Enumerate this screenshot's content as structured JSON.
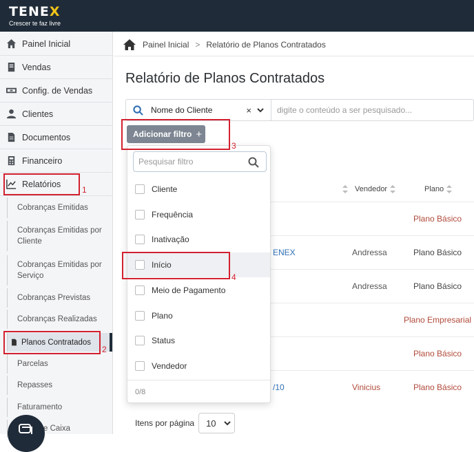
{
  "header": {
    "brand": "TENE",
    "brand_x": "X",
    "tagline": "Crescer te faz livre"
  },
  "sidebar": {
    "items": [
      {
        "label": "Painel Inicial",
        "icon": "home-icon"
      },
      {
        "label": "Vendas",
        "icon": "book-icon"
      },
      {
        "label": "Config. de Vendas",
        "icon": "money-icon"
      },
      {
        "label": "Clientes",
        "icon": "user-icon"
      },
      {
        "label": "Documentos",
        "icon": "document-icon"
      },
      {
        "label": "Financeiro",
        "icon": "calculator-icon"
      },
      {
        "label": "Relatórios",
        "icon": "chart-line-icon"
      }
    ],
    "subitems": [
      "Cobranças Emitidas",
      "Cobranças Emitidas por Cliente",
      "Cobranças Emitidas por Serviço",
      "Cobranças Previstas",
      "Cobranças Realizadas",
      "Planos Contratados",
      "Parcelas",
      "Repasses",
      "Faturamento",
      "Fluxo de Caixa"
    ],
    "subitems_visible": [
      "Cobranças Emitidas",
      "Cobranças Emitidas por\nCliente",
      "Cobranças Emitidas por\nServiço",
      "Cobranças Previstas",
      "Cobranças Realizadas",
      "Planos Contratados",
      "Parcelas",
      "Repasses",
      "Faturamento",
      "e Caixa"
    ]
  },
  "breadcrumb": {
    "home": "Painel Inicial",
    "sep": ">",
    "current": "Relatório de Planos Contratados"
  },
  "page": {
    "title": "Relatório de Planos Contratados"
  },
  "search": {
    "field": "Nome do Cliente",
    "clear": "×",
    "placeholder": "digite o conteúdo a ser pesquisado..."
  },
  "filter": {
    "add_label": "Adicionar filtro",
    "plus": "+",
    "search_placeholder": "Pesquisar filtro",
    "options": [
      "Cliente",
      "Frequência",
      "Inativação",
      "Início",
      "Meio de Pagamento",
      "Plano",
      "Status",
      "Vendedor"
    ],
    "count": "0/8"
  },
  "table": {
    "headers": {
      "vendedor": "Vendedor",
      "plano": "Plano"
    },
    "rows": [
      {
        "cliente": "",
        "vendedor": "",
        "plano": "Plano Básico"
      },
      {
        "cliente": "ENEX",
        "vendedor": "Andressa",
        "plano": "Plano Básico"
      },
      {
        "cliente": "",
        "vendedor": "Andressa",
        "plano": "Plano Básico"
      },
      {
        "cliente": "",
        "vendedor": "",
        "plano": "Plano Empresarial"
      },
      {
        "cliente": "",
        "vendedor": "",
        "plano": "Plano Básico"
      },
      {
        "cliente": "/10",
        "vendedor": "Vinicius",
        "plano": "Plano Básico"
      }
    ]
  },
  "pager": {
    "label": "Itens por página",
    "value": "10"
  },
  "annotations": [
    "1",
    "2",
    "3",
    "4"
  ],
  "colors": {
    "accent": "#d2202f",
    "topbar": "#1f2b38",
    "link": "#2f6fb5",
    "plan": "#b04a3a"
  }
}
